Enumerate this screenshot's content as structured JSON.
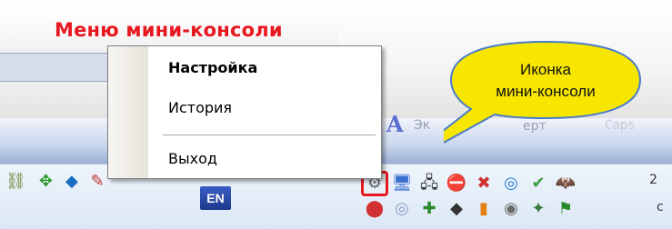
{
  "title": "Меню мини-консоли",
  "menu": {
    "items": [
      {
        "label": "Настройка",
        "default": true
      },
      {
        "label": "История",
        "default": false
      },
      {
        "label": "Выход",
        "default": false
      }
    ]
  },
  "callout": {
    "line1": "Иконка",
    "line2": "мини-консоли",
    "color": "#f7e600"
  },
  "toolbar": {
    "text1": "Эк",
    "text2": "ерт",
    "caps": "Caps"
  },
  "tray": {
    "language": "EN",
    "clock_partial_1": "2",
    "clock_partial_2": "c"
  },
  "colors": {
    "title": "#e8171f",
    "highlight_box": "#e8171f"
  }
}
